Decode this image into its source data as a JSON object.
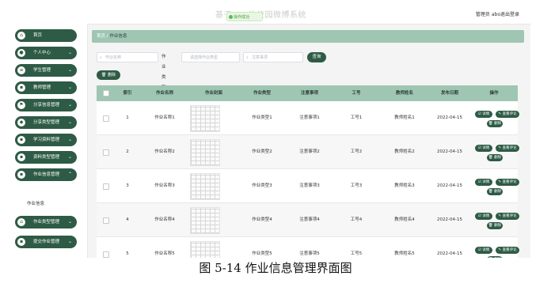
{
  "header": {
    "site_title": "基于php的校园微博系统",
    "toast": "操作成功",
    "admin_label": "管理员 abo",
    "logout_label": "退出登录"
  },
  "sidebar": {
    "items": [
      {
        "label": "首页",
        "icon": "home-icon"
      },
      {
        "label": "个人中心",
        "icon": "user-icon"
      },
      {
        "label": "学生管理",
        "icon": "menu-icon"
      },
      {
        "label": "教师管理",
        "icon": "grid-icon"
      },
      {
        "label": "分享信息管理",
        "icon": "flag-icon"
      },
      {
        "label": "分享类型管理",
        "icon": "location-icon"
      },
      {
        "label": "学习资料管理",
        "icon": "grid-icon"
      },
      {
        "label": "资料类型管理",
        "icon": "grid-icon"
      },
      {
        "label": "作业信息管理",
        "icon": "grid-icon"
      },
      {
        "label": "作业类型管理",
        "icon": "home-icon"
      },
      {
        "label": "提交作业管理",
        "icon": "grid-icon"
      }
    ],
    "sub_item": "作业信息"
  },
  "breadcrumb": {
    "home": "首页",
    "sep": "/",
    "current": "作业信息"
  },
  "filters": {
    "name_placeholder": "作业名称",
    "type_label": "作业类型",
    "type_placeholder": "请选择作业类型",
    "notes_placeholder": "注意事项",
    "search_button": "查询"
  },
  "delete_button": "删除",
  "table": {
    "headers": [
      "索引",
      "作业名称",
      "作业封面",
      "作业类型",
      "注意事项",
      "工号",
      "教师姓名",
      "发布日期",
      "操作"
    ],
    "rows": [
      {
        "idx": "1",
        "name": "作业名称1",
        "type": "作业类型1",
        "notes": "注意事项1",
        "id": "工号1",
        "teacher": "教师姓名1",
        "date": "2022-04-15"
      },
      {
        "idx": "2",
        "name": "作业名称2",
        "type": "作业类型2",
        "notes": "注意事项2",
        "id": "工号2",
        "teacher": "教师姓名2",
        "date": "2022-04-15"
      },
      {
        "idx": "3",
        "name": "作业名称3",
        "type": "作业类型3",
        "notes": "注意事项3",
        "id": "工号3",
        "teacher": "教师姓名3",
        "date": "2022-04-15"
      },
      {
        "idx": "4",
        "name": "作业名称4",
        "type": "作业类型4",
        "notes": "注意事项4",
        "id": "工号4",
        "teacher": "教师姓名4",
        "date": "2022-04-15"
      },
      {
        "idx": "5",
        "name": "作业名称5",
        "type": "作业类型5",
        "notes": "注意事项5",
        "id": "工号5",
        "teacher": "教师姓名5",
        "date": "2022-04-15"
      }
    ],
    "actions": {
      "detail": "详情",
      "comment": "查看评论",
      "delete": "删除"
    }
  },
  "caption": "图 5-14 作业信息管理界面图",
  "colors": {
    "primary": "#2e5b45",
    "header_bg": "#9fc6b3"
  }
}
